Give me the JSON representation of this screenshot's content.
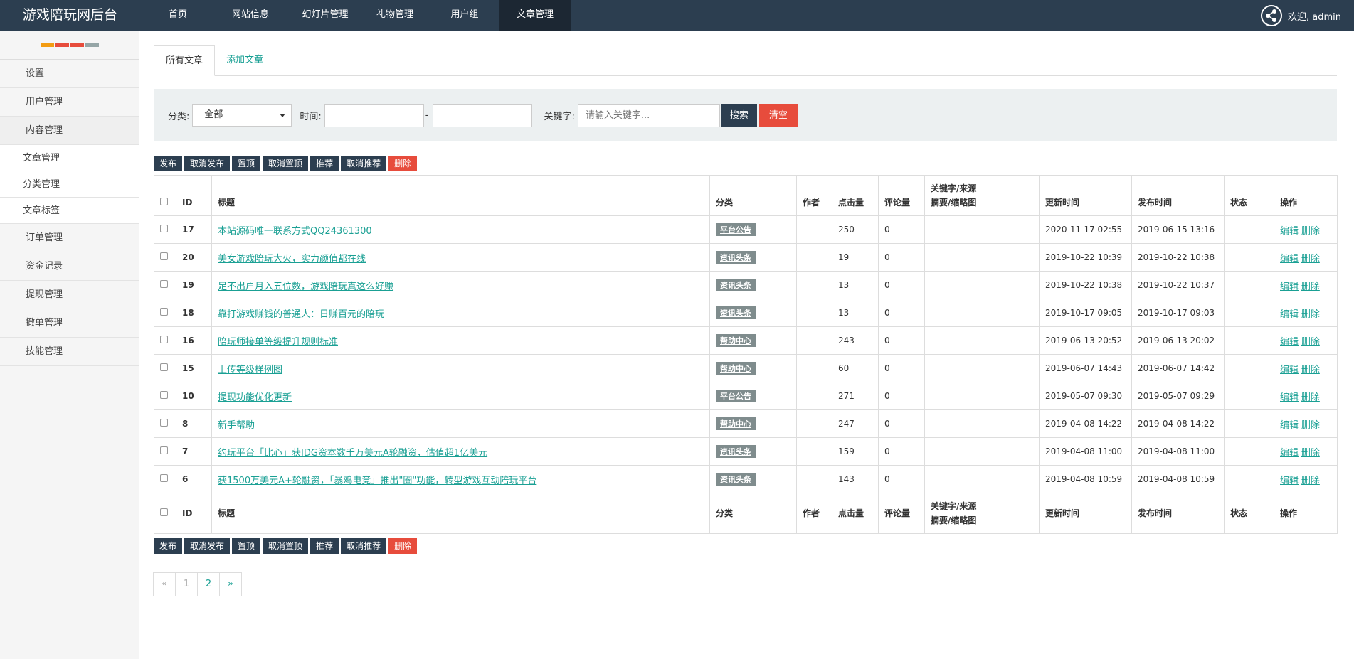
{
  "topbar": {
    "brand": "游戏陪玩网后台",
    "nav": [
      {
        "label": "首页",
        "width": 92
      },
      {
        "label": "网站信息",
        "width": 112
      },
      {
        "label": "幻灯片管理",
        "width": 98
      },
      {
        "label": "礼物管理",
        "width": 98
      },
      {
        "label": "用户组",
        "width": 98
      },
      {
        "label": "文章管理",
        "width": 100,
        "active": true
      }
    ],
    "welcome": "欢迎, admin",
    "icon": "share-icon"
  },
  "sidebar": {
    "dot_colors": [
      "#f39c12",
      "#e74c3c",
      "#e74c3c",
      "#95a5a6"
    ],
    "items": [
      {
        "label": "设置",
        "type": "item"
      },
      {
        "label": "用户管理",
        "type": "item"
      },
      {
        "label": "内容管理",
        "type": "item",
        "active": true
      },
      {
        "label": "文章管理",
        "type": "sub"
      },
      {
        "label": "分类管理",
        "type": "sub"
      },
      {
        "label": "文章标签",
        "type": "sub"
      },
      {
        "label": "订单管理",
        "type": "item"
      },
      {
        "label": "资金记录",
        "type": "item"
      },
      {
        "label": "提现管理",
        "type": "item"
      },
      {
        "label": "撤单管理",
        "type": "item"
      },
      {
        "label": "技能管理",
        "type": "item"
      }
    ]
  },
  "tabs": {
    "all": "所有文章",
    "add": "添加文章"
  },
  "filter": {
    "category_label": "分类:",
    "category_value": "全部",
    "time_label": "时间:",
    "dash": "-",
    "keyword_label": "关键字:",
    "keyword_placeholder": "请输入关键字...",
    "search": "搜索",
    "clear": "清空"
  },
  "actions": [
    "发布",
    "取消发布",
    "置顶",
    "取消置顶",
    "推荐",
    "取消推荐",
    "删除"
  ],
  "table": {
    "headers": {
      "id": "ID",
      "title": "标题",
      "category": "分类",
      "author": "作者",
      "hits": "点击量",
      "comments": "评论量",
      "keywords_line1": "关键字/来源",
      "keywords_line2": "摘要/缩略图",
      "updated": "更新时间",
      "published": "发布时间",
      "status": "状态",
      "ops": "操作"
    },
    "edit": "编辑",
    "delete": "删除",
    "rows": [
      {
        "id": "17",
        "title": "本站源码唯一联系方式QQ24361300",
        "category": "平台公告",
        "hits": "250",
        "comments": "0",
        "updated": "2020-11-17 02:55",
        "published": "2019-06-15 13:16"
      },
      {
        "id": "20",
        "title": "美女游戏陪玩大火，实力颜值都在线",
        "category": "资讯头条",
        "hits": "19",
        "comments": "0",
        "updated": "2019-10-22 10:39",
        "published": "2019-10-22 10:38"
      },
      {
        "id": "19",
        "title": "足不出户月入五位数，游戏陪玩真这么好赚",
        "category": "资讯头条",
        "hits": "13",
        "comments": "0",
        "updated": "2019-10-22 10:38",
        "published": "2019-10-22 10:37"
      },
      {
        "id": "18",
        "title": "靠打游戏赚钱的普通人：日赚百元的陪玩",
        "category": "资讯头条",
        "hits": "13",
        "comments": "0",
        "updated": "2019-10-17 09:05",
        "published": "2019-10-17 09:03"
      },
      {
        "id": "16",
        "title": "陪玩师接单等级提升规则标准",
        "category": "帮助中心",
        "hits": "243",
        "comments": "0",
        "updated": "2019-06-13 20:52",
        "published": "2019-06-13 20:02"
      },
      {
        "id": "15",
        "title": "上传等级样例图",
        "category": "帮助中心",
        "hits": "60",
        "comments": "0",
        "updated": "2019-06-07 14:43",
        "published": "2019-06-07 14:42"
      },
      {
        "id": "10",
        "title": "提现功能优化更新",
        "category": "平台公告",
        "hits": "271",
        "comments": "0",
        "updated": "2019-05-07 09:30",
        "published": "2019-05-07 09:29"
      },
      {
        "id": "8",
        "title": "新手帮助",
        "category": "帮助中心",
        "hits": "247",
        "comments": "0",
        "updated": "2019-04-08 14:22",
        "published": "2019-04-08 14:22"
      },
      {
        "id": "7",
        "title": "约玩平台「比心」获IDG资本数千万美元A轮融资，估值超1亿美元",
        "category": "资讯头条",
        "hits": "159",
        "comments": "0",
        "updated": "2019-04-08 11:00",
        "published": "2019-04-08 11:00"
      },
      {
        "id": "6",
        "title": "获1500万美元A+轮融资，「暴鸡电竞」推出\"圈\"功能，转型游戏互动陪玩平台",
        "category": "资讯头条",
        "hits": "143",
        "comments": "0",
        "updated": "2019-04-08 10:59",
        "published": "2019-04-08 10:59"
      }
    ]
  },
  "pagination": {
    "prev": "«",
    "pages": [
      "1",
      "2"
    ],
    "current": "1",
    "next": "»"
  }
}
